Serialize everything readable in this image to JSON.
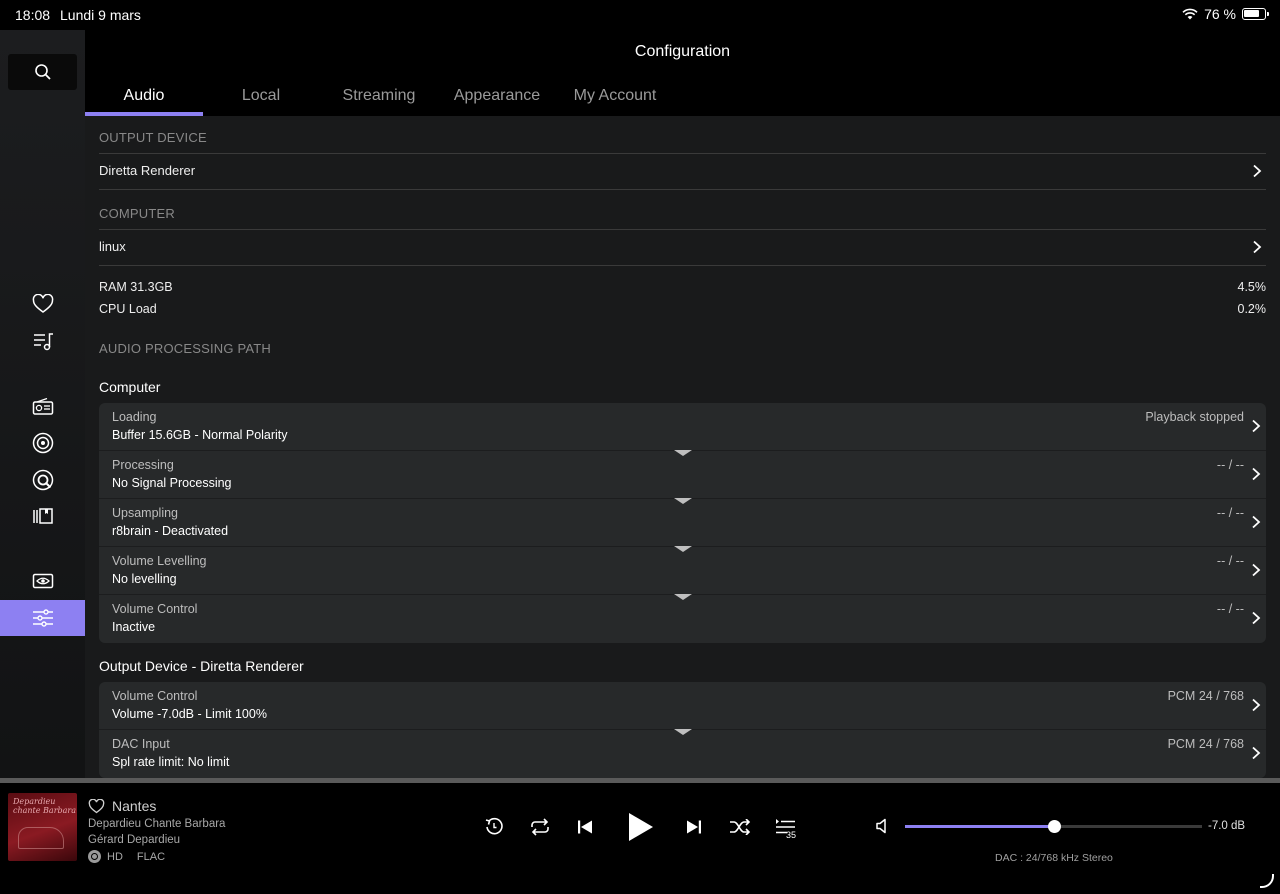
{
  "status_bar": {
    "time": "18:08",
    "date": "Lundi 9 mars",
    "battery": "76 %"
  },
  "sidebar": {
    "icons": [
      "search-icon",
      "heart-icon",
      "playlist-icon",
      "radio-icon",
      "podcast-icon",
      "qobuz-icon",
      "library-icon",
      "hidden-icon",
      "settings-icon"
    ],
    "active": "settings-icon"
  },
  "header": {
    "title": "Configuration"
  },
  "tabs": [
    "Audio",
    "Local",
    "Streaming",
    "Appearance",
    "My Account"
  ],
  "active_tab": "Audio",
  "sections": {
    "output_device": {
      "heading": "OUTPUT DEVICE",
      "value": "Diretta Renderer"
    },
    "computer": {
      "heading": "COMPUTER",
      "value": "linux"
    },
    "ram": {
      "label": "RAM 31.3GB",
      "value": "4.5%"
    },
    "cpu": {
      "label": "CPU Load",
      "value": "0.2%"
    },
    "audio_path": {
      "heading": "AUDIO PROCESSING PATH"
    }
  },
  "computer_group": {
    "title": "Computer",
    "rows": [
      {
        "title": "Loading",
        "subtitle": "Buffer 15.6GB - Normal Polarity",
        "right": "Playback stopped"
      },
      {
        "title": "Processing",
        "subtitle": "No Signal Processing",
        "right": "-- / --"
      },
      {
        "title": "Upsampling",
        "subtitle": "r8brain - Deactivated",
        "right": "-- / --"
      },
      {
        "title": "Volume Levelling",
        "subtitle": "No levelling",
        "right": "-- / --"
      },
      {
        "title": "Volume Control",
        "subtitle": "Inactive",
        "right": "-- / --"
      }
    ]
  },
  "output_group": {
    "title": "Output Device - Diretta Renderer",
    "rows": [
      {
        "title": "Volume Control",
        "subtitle": "Volume -7.0dB - Limit 100%",
        "right": "PCM 24 / 768"
      },
      {
        "title": "DAC Input",
        "subtitle": "Spl rate limit: No limit",
        "right": "PCM 24 / 768"
      }
    ]
  },
  "player": {
    "track": "Nantes",
    "album": "Depardieu Chante Barbara",
    "artist": "Gérard Depardieu",
    "quality": "HD",
    "format": "FLAC",
    "art_text": "Depardieu chante Barbara",
    "queue_count": "35",
    "volume_db": "-7.0 dB",
    "volume_level": 0.5,
    "dac_info": "DAC : 24/768 kHz Stereo",
    "accent_color": "#8d80f2"
  }
}
